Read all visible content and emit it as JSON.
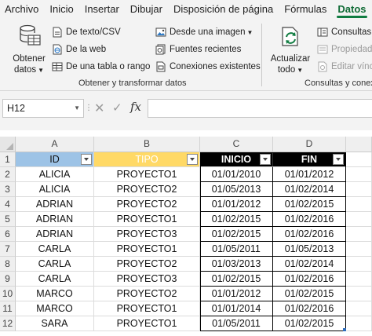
{
  "menu": {
    "tabs": [
      "Archivo",
      "Inicio",
      "Insertar",
      "Dibujar",
      "Disposición de página",
      "Fórmulas",
      "Datos"
    ],
    "active": "Datos"
  },
  "ribbon": {
    "get_data_label_1": "Obtener",
    "get_data_label_2": "datos",
    "from_text_csv": "De texto/CSV",
    "from_web": "De la web",
    "from_table": "De una tabla o rango",
    "from_image": "Desde una imagen",
    "recent_sources": "Fuentes recientes",
    "existing_connections": "Conexiones existentes",
    "group1_label": "Obtener y transformar datos",
    "refresh_label_1": "Actualizar",
    "refresh_label_2": "todo",
    "queries": "Consultas y",
    "properties": "Propiedade",
    "edit_links": "Editar víncu",
    "group2_label": "Consultas y conexi"
  },
  "formula_bar": {
    "name_box": "H12",
    "fx": "fx",
    "formula": ""
  },
  "grid": {
    "columns": [
      "A",
      "B",
      "C",
      "D"
    ],
    "rows": [
      "1",
      "2",
      "3",
      "4",
      "5",
      "6",
      "7",
      "8",
      "9",
      "10",
      "11",
      "12"
    ],
    "header": [
      "ID",
      "TIPO",
      "INICIO",
      "FIN"
    ],
    "data": [
      [
        "ALICIA",
        "PROYECTO1",
        "01/01/2010",
        "01/01/2012"
      ],
      [
        "ALICIA",
        "PROYECTO2",
        "01/05/2013",
        "01/02/2014"
      ],
      [
        "ADRIAN",
        "PROYECTO2",
        "01/01/2012",
        "01/02/2015"
      ],
      [
        "ADRIAN",
        "PROYECTO1",
        "01/02/2015",
        "01/02/2016"
      ],
      [
        "ADRIAN",
        "PROYECTO3",
        "01/02/2015",
        "01/02/2016"
      ],
      [
        "CARLA",
        "PROYECTO1",
        "01/05/2011",
        "01/05/2013"
      ],
      [
        "CARLA",
        "PROYECTO2",
        "01/03/2013",
        "01/02/2014"
      ],
      [
        "CARLA",
        "PROYECTO3",
        "01/02/2015",
        "01/02/2016"
      ],
      [
        "MARCO",
        "PROYECTO2",
        "01/01/2012",
        "01/02/2015"
      ],
      [
        "MARCO",
        "PROYECTO1",
        "01/01/2014",
        "01/02/2016"
      ],
      [
        "SARA",
        "PROYECTO1",
        "01/05/2011",
        "01/02/2015"
      ]
    ]
  },
  "colors": {
    "accent": "#107c41",
    "id_header": "#9dc3e6",
    "tipo_header": "#ffd966",
    "dark_header": "#000000"
  }
}
